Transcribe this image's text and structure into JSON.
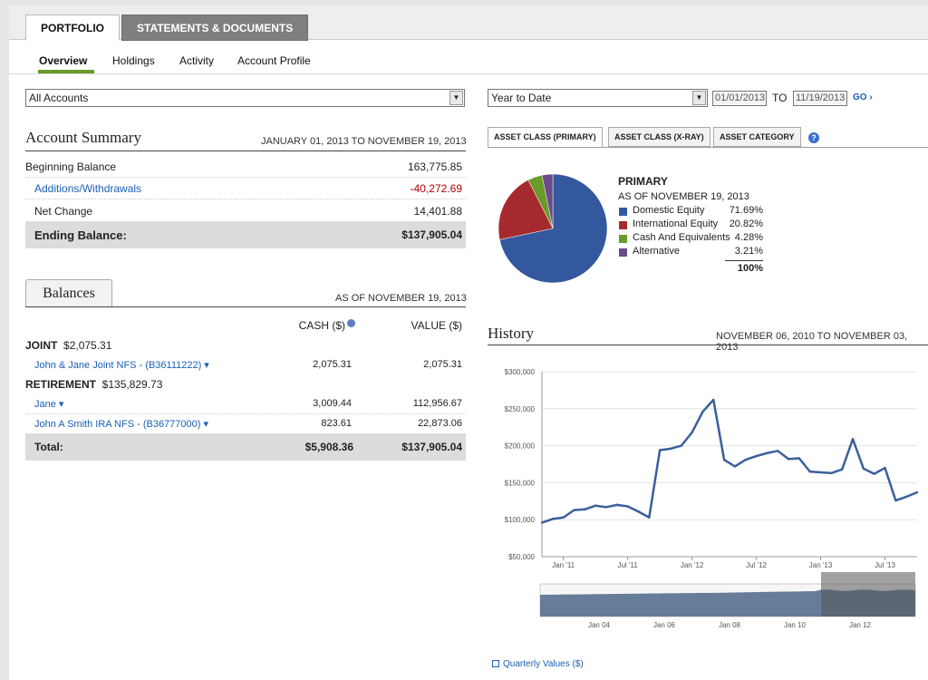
{
  "tabs": {
    "portfolio": "PORTFOLIO",
    "statements": "STATEMENTS & DOCUMENTS"
  },
  "subnav": {
    "overview": "Overview",
    "holdings": "Holdings",
    "activity": "Activity",
    "profile": "Account Profile"
  },
  "accounts_select": {
    "value": "All Accounts"
  },
  "period": {
    "value": "Year to Date",
    "from": "01/01/2013",
    "to_label": "TO",
    "to": "11/19/2013",
    "go": "GO ›"
  },
  "account_summary": {
    "title": "Account Summary",
    "range": "JANUARY 01, 2013 TO NOVEMBER 19, 2013",
    "rows": [
      {
        "label": "Beginning Balance",
        "value": "163,775.85"
      },
      {
        "label": "Additions/Withdrawals",
        "value": "-40,272.69"
      },
      {
        "label": "Net Change",
        "value": "14,401.88"
      }
    ],
    "ending_label": "Ending Balance:",
    "ending_value": "$137,905.04"
  },
  "balances": {
    "tab": "Balances",
    "as_of": "AS OF NOVEMBER 19, 2013",
    "col_cash": "CASH ($)",
    "col_value": "VALUE ($)",
    "groups": [
      {
        "name": "JOINT",
        "total": "$2,075.31"
      },
      {
        "name": "RETIREMENT",
        "total": "$135,829.73"
      }
    ],
    "accounts": [
      {
        "name": "John & Jane Joint NFS - (B36111222) ▾",
        "cash": "2,075.31",
        "value": "2,075.31"
      },
      {
        "name": "Jane ▾",
        "cash": "3,009.44",
        "value": "112,956.67"
      },
      {
        "name": "John A Smith IRA NFS - (B36777000) ▾",
        "cash": "823.61",
        "value": "22,873.06"
      }
    ],
    "total_label": "Total:",
    "total_cash": "$5,908.36",
    "total_value": "$137,905.04"
  },
  "asset_tabs": [
    "ASSET CLASS (PRIMARY)",
    "ASSET CLASS (X-RAY)",
    "ASSET CATEGORY"
  ],
  "allocation": {
    "title": "PRIMARY",
    "as_of": "AS OF NOVEMBER 19, 2013",
    "total": "100%",
    "items": [
      {
        "label": "Domestic Equity",
        "pct": "71.69%",
        "value": 71.69,
        "color": "#34589e"
      },
      {
        "label": "International Equity",
        "pct": "20.82%",
        "value": 20.82,
        "color": "#a52a2d"
      },
      {
        "label": "Cash And Equivalents",
        "pct": "4.28%",
        "value": 4.28,
        "color": "#6a9a2a"
      },
      {
        "label": "Alternative",
        "pct": "3.21%",
        "value": 3.21,
        "color": "#6a4a8a"
      }
    ]
  },
  "history": {
    "title": "History",
    "range": "NOVEMBER 06, 2010 TO NOVEMBER 03, 2013",
    "quarterly_link": "Quarterly Values ($)"
  },
  "chart_data": {
    "type": "line",
    "yticks": [
      "$300,000",
      "$250,000",
      "$200,000",
      "$150,000",
      "$100,000",
      "$50,000"
    ],
    "xticks": [
      "Jan '11",
      "Jul '11",
      "Jan '12",
      "Jul '12",
      "Jan '13",
      "Jul '13"
    ],
    "ylim": [
      50000,
      300000
    ],
    "xlim": [
      0,
      35
    ],
    "x": [
      0,
      1,
      2,
      3,
      4,
      5,
      6,
      7,
      8,
      9,
      10,
      11,
      12,
      13,
      14,
      15,
      16,
      17,
      18,
      19,
      20,
      21,
      22,
      23,
      24,
      25,
      26,
      27,
      28,
      29,
      30,
      31,
      32,
      33,
      34,
      35
    ],
    "values": [
      96000,
      101000,
      103000,
      113000,
      114000,
      119000,
      117000,
      120000,
      118000,
      111000,
      103000,
      194000,
      196000,
      200000,
      218000,
      246000,
      262000,
      181000,
      172000,
      181000,
      186000,
      190000,
      193000,
      182000,
      183000,
      165000,
      164000,
      163000,
      168000,
      209000,
      169000,
      162000,
      170000,
      126000,
      131000,
      137000
    ],
    "navigator_labels": [
      "Jan 04",
      "Jan 06",
      "Jan 08",
      "Jan 10",
      "Jan 12"
    ],
    "line_color": "#3b5f9c"
  }
}
